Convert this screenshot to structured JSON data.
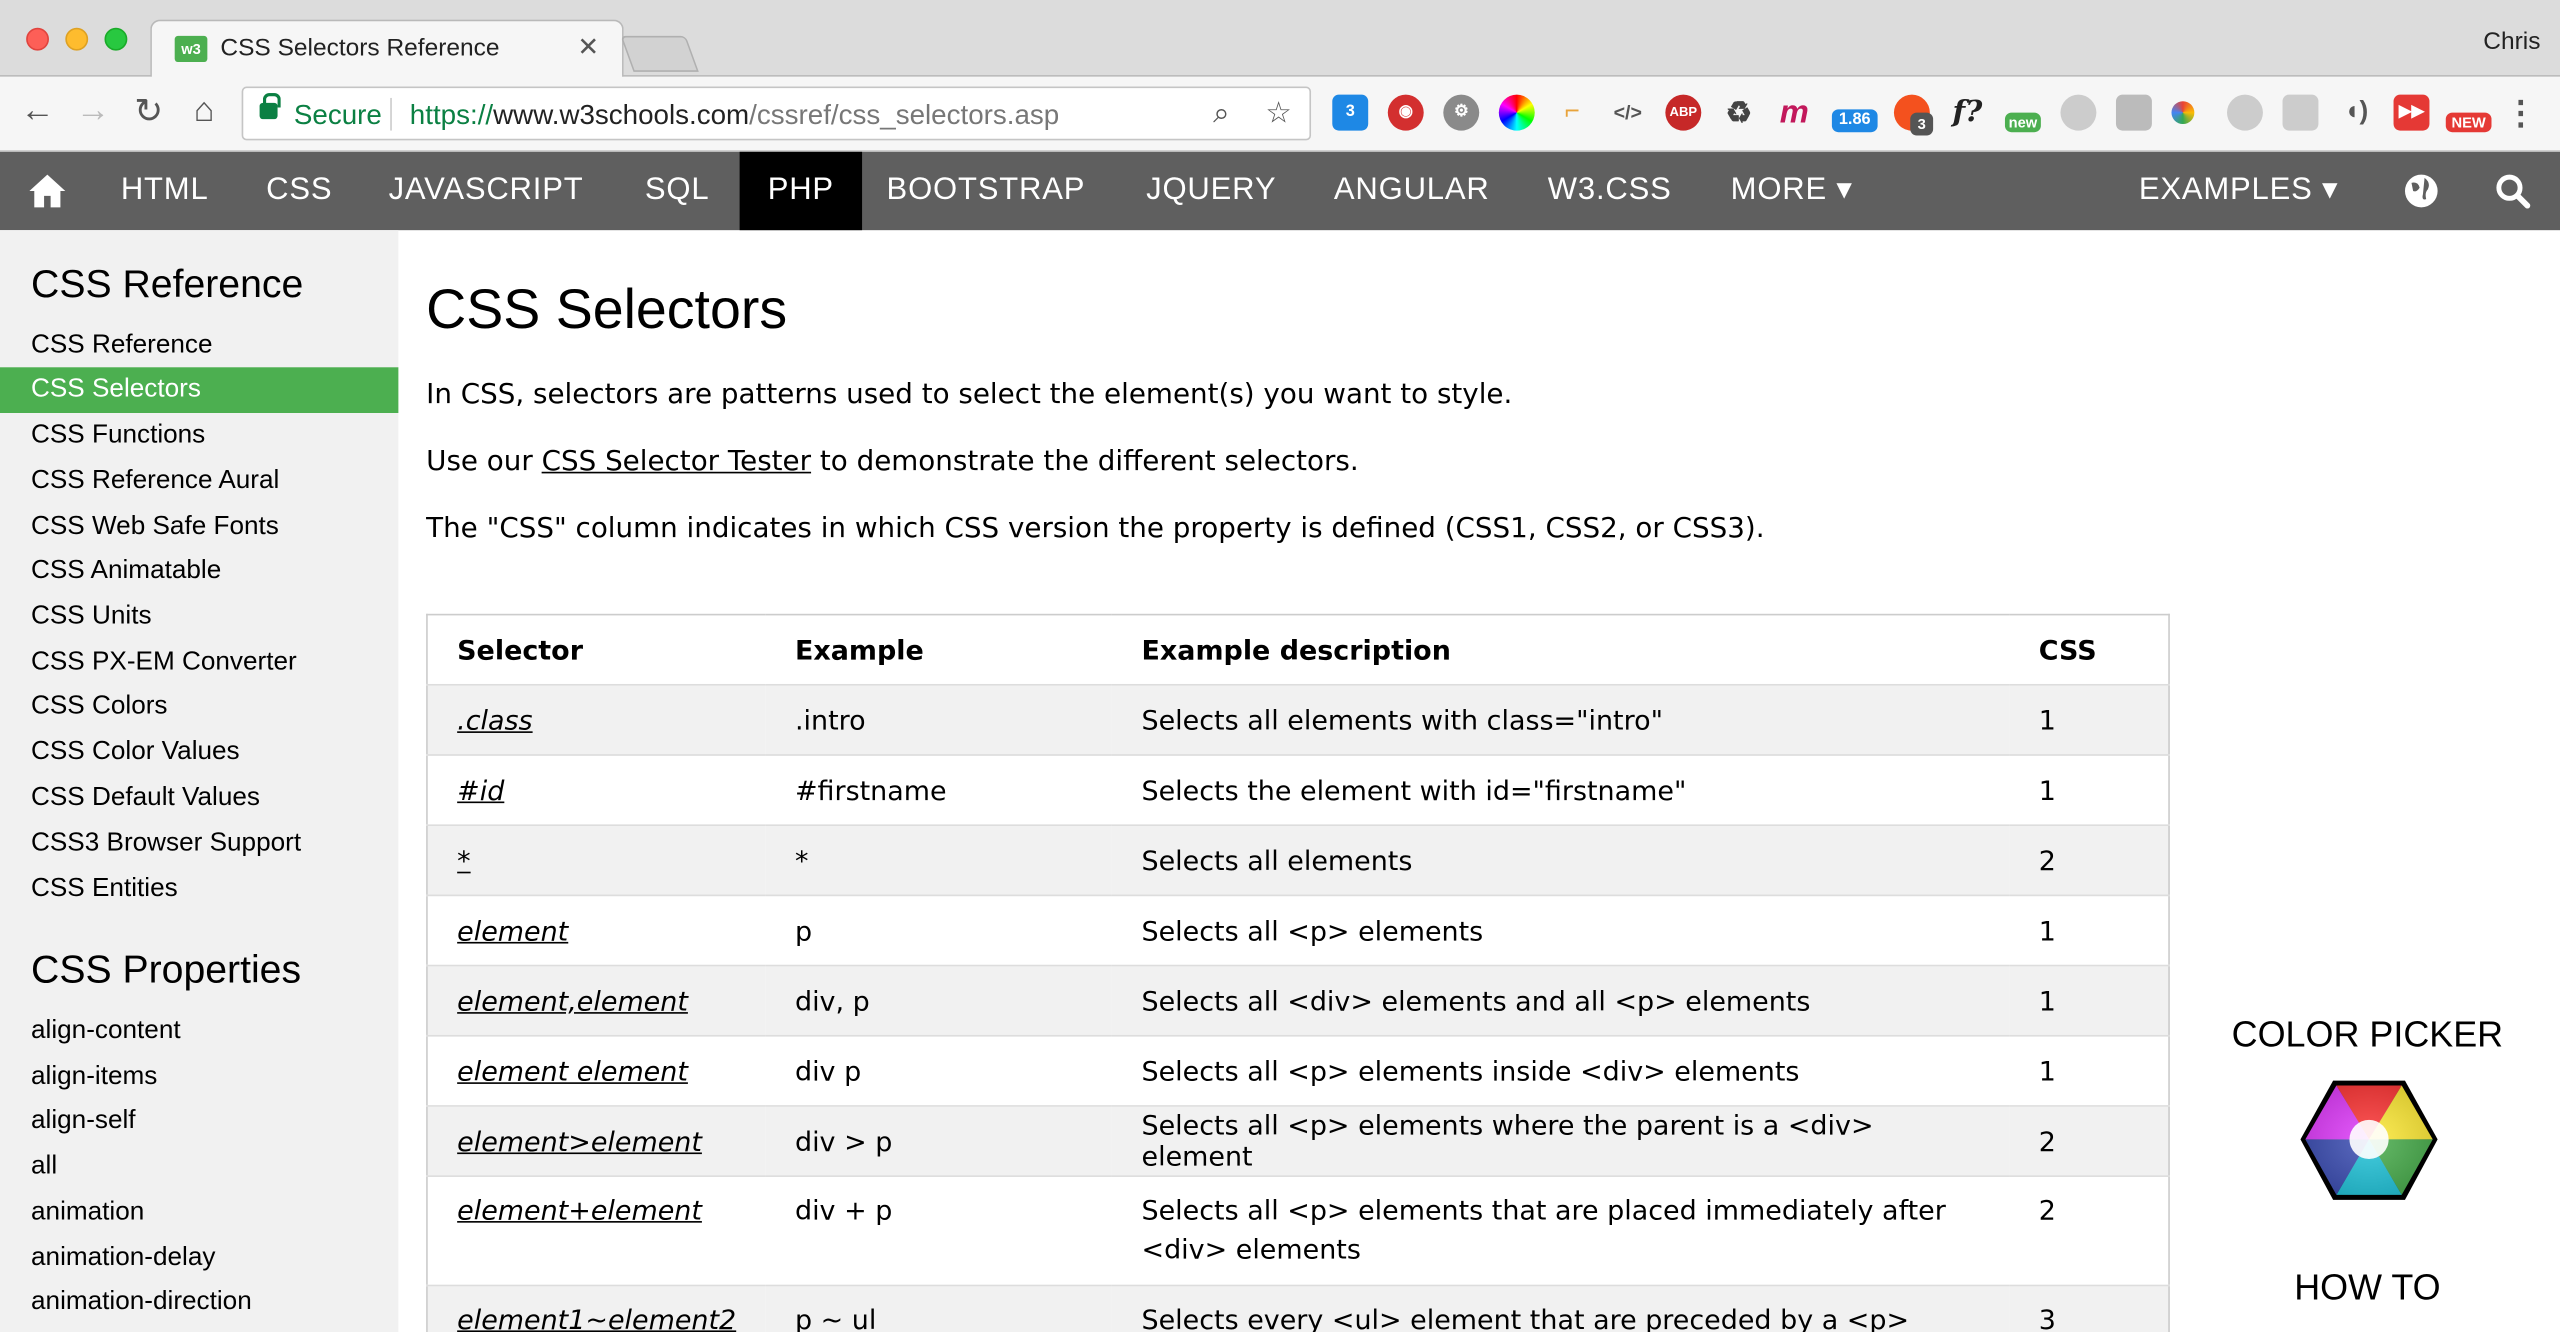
{
  "browser": {
    "tab_title": "CSS Selectors Reference",
    "tab_favicon": "w3",
    "profile": "Chris",
    "security_label": "Secure",
    "url_scheme": "https://",
    "url_host": "www.w3schools.com",
    "url_path": "/cssref/css_selectors.asp",
    "extension_badges": {
      "counter": "1.86",
      "count3": "3",
      "new1": "new",
      "new2": "NEW",
      "abp": "ABP",
      "fq": "f?"
    }
  },
  "topnav": {
    "items": [
      "HTML",
      "CSS",
      "JAVASCRIPT",
      "SQL",
      "PHP",
      "BOOTSTRAP",
      "JQUERY",
      "ANGULAR",
      "W3.CSS",
      "MORE ▾"
    ],
    "active": "PHP",
    "examples": "EXAMPLES ▾"
  },
  "sidebar": {
    "heading1": "CSS Reference",
    "links1": [
      "CSS Reference",
      "CSS Selectors",
      "CSS Functions",
      "CSS Reference Aural",
      "CSS Web Safe Fonts",
      "CSS Animatable",
      "CSS Units",
      "CSS PX-EM Converter",
      "CSS Colors",
      "CSS Color Values",
      "CSS Default Values",
      "CSS3 Browser Support",
      "CSS Entities"
    ],
    "active_link": "CSS Selectors",
    "heading2": "CSS Properties",
    "links2": [
      "align-content",
      "align-items",
      "align-self",
      "all",
      "animation",
      "animation-delay",
      "animation-direction"
    ]
  },
  "main": {
    "title": "CSS Selectors",
    "intro": "In CSS, selectors are patterns used to select the element(s) you want to style.",
    "tester_prefix": "Use our ",
    "tester_link": "CSS Selector Tester",
    "tester_suffix": " to demonstrate the different selectors.",
    "css_note": "The \"CSS\" column indicates in which CSS version the property is defined (CSS1, CSS2, or CSS3).",
    "table": {
      "headers": [
        "Selector",
        "Example",
        "Example description",
        "CSS"
      ],
      "rows": [
        [
          ".class",
          ".intro",
          "Selects all elements with class=\"intro\"",
          "1"
        ],
        [
          "#id",
          "#firstname",
          "Selects the element with id=\"firstname\"",
          "1"
        ],
        [
          "*",
          "*",
          "Selects all elements",
          "2"
        ],
        [
          "element",
          "p",
          "Selects all <p> elements",
          "1"
        ],
        [
          "element,element",
          "div, p",
          "Selects all <div> elements and all <p> elements",
          "1"
        ],
        [
          "element element",
          "div p",
          "Selects all <p> elements inside <div> elements",
          "1"
        ],
        [
          "element>element",
          "div > p",
          "Selects all <p> elements where the parent is a <div> element",
          "2"
        ],
        [
          "element+element",
          "div + p",
          "Selects all <p> elements that are placed immediately after <div> elements",
          "2"
        ],
        [
          "element1~element2",
          "p ~ ul",
          "Selects every <ul> element that are preceded by a <p>",
          "3"
        ]
      ]
    }
  },
  "rail": {
    "color_picker": "COLOR PICKER",
    "how_to": "HOW TO"
  }
}
